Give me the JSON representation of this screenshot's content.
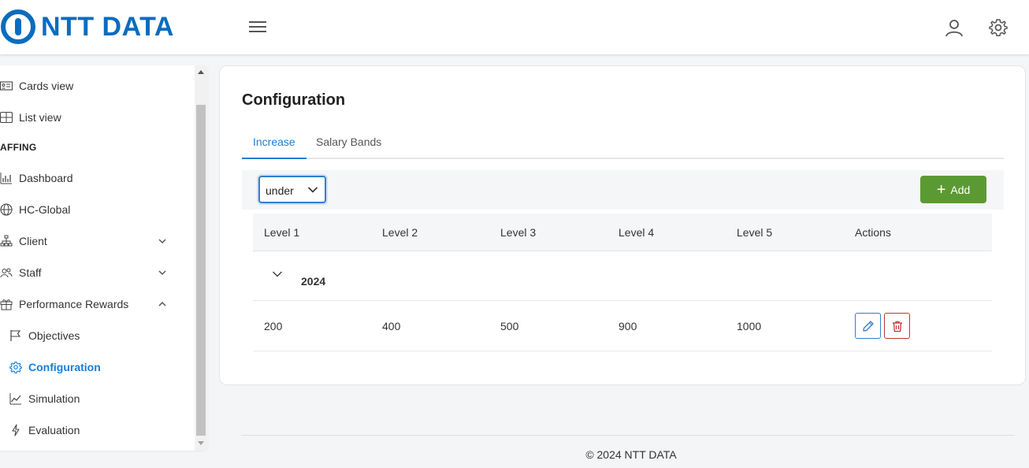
{
  "header": {
    "logo_text": "NTT DATA",
    "brand_color": "#0a6cbf",
    "menu_icon": "hamburger-icon",
    "user_icon": "user-icon",
    "settings_icon": "gear-icon"
  },
  "sidebar": {
    "items_top": [
      {
        "label": "Cards view",
        "icon": "id-card-icon"
      },
      {
        "label": "List view",
        "icon": "table-icon"
      }
    ],
    "section_label": "AFFING",
    "items": [
      {
        "label": "Dashboard",
        "icon": "bar-chart-icon"
      },
      {
        "label": "HC-Global",
        "icon": "globe-icon"
      },
      {
        "label": "Client",
        "icon": "sitemap-icon"
      },
      {
        "label": "Staff",
        "icon": "users-icon"
      },
      {
        "label": "Performance Rewards",
        "icon": "gift-icon"
      }
    ],
    "sub_items": [
      {
        "label": "Objectives",
        "icon": "flag-icon"
      },
      {
        "label": "Configuration",
        "icon": "gear-icon",
        "active": true
      },
      {
        "label": "Simulation",
        "icon": "line-chart-icon"
      },
      {
        "label": "Evaluation",
        "icon": "lightning-icon"
      }
    ],
    "active_color": "#1a7ed6"
  },
  "main": {
    "title": "Configuration",
    "tabs": [
      {
        "label": "Increase",
        "active": true
      },
      {
        "label": "Salary Bands",
        "active": false
      }
    ],
    "filter": {
      "selected": "under"
    },
    "add_button": {
      "label": "Add",
      "color": "#5b9a33"
    },
    "table": {
      "columns": [
        "Level 1",
        "Level 2",
        "Level 3",
        "Level 4",
        "Level 5",
        "Actions"
      ],
      "group_label": "2024",
      "rows": [
        {
          "values": [
            "200",
            "400",
            "500",
            "900",
            "1000"
          ]
        }
      ]
    }
  },
  "footer": {
    "text": "© 2024 NTT DATA"
  }
}
